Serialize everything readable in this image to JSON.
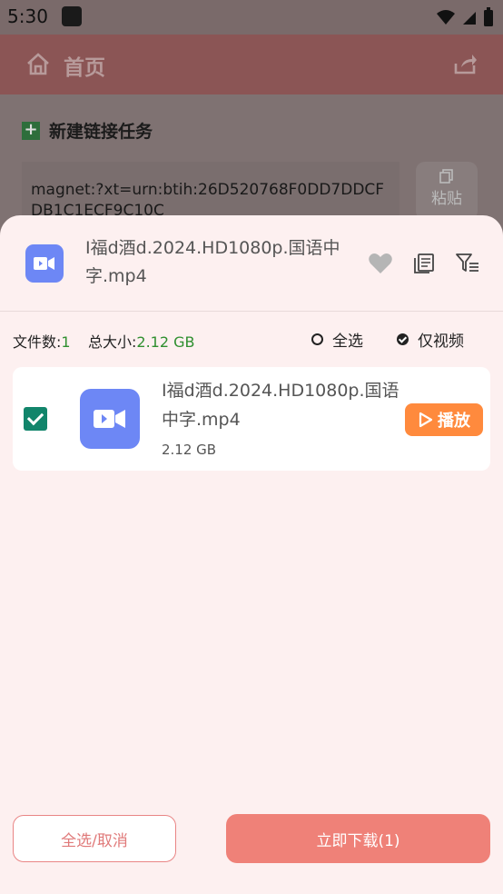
{
  "status_bar": {
    "time": "5:30"
  },
  "app_bar": {
    "title": "首页"
  },
  "background": {
    "task_title": "新建链接任务",
    "magnet_text": "magnet:?xt=urn:btih:26D520768F0DD7DDCFDB1C1ECF9C10C",
    "paste_label": "粘贴"
  },
  "sheet": {
    "header_filename": "I福d酒d.2024.HD1080p.国语中字.mp4",
    "stats": {
      "file_count_label": "文件数:",
      "file_count": "1",
      "total_size_label": "总大小:",
      "total_size": "2.12 GB"
    },
    "options": {
      "select_all": "全选",
      "video_only": "仅视频"
    },
    "files": [
      {
        "name": "I福d酒d.2024.HD1080p.国语中字.mp4",
        "size": "2.12 GB",
        "checked": true,
        "play_label": "播放"
      }
    ],
    "buttons": {
      "select_toggle": "全选/取消",
      "download": "立即下载(1)"
    }
  },
  "colors": {
    "accent": "#ef8178",
    "play": "#ff8a3d",
    "video_icon": "#6d87f5",
    "checkbox": "#12856b",
    "stat_value": "#2f8f2f"
  }
}
